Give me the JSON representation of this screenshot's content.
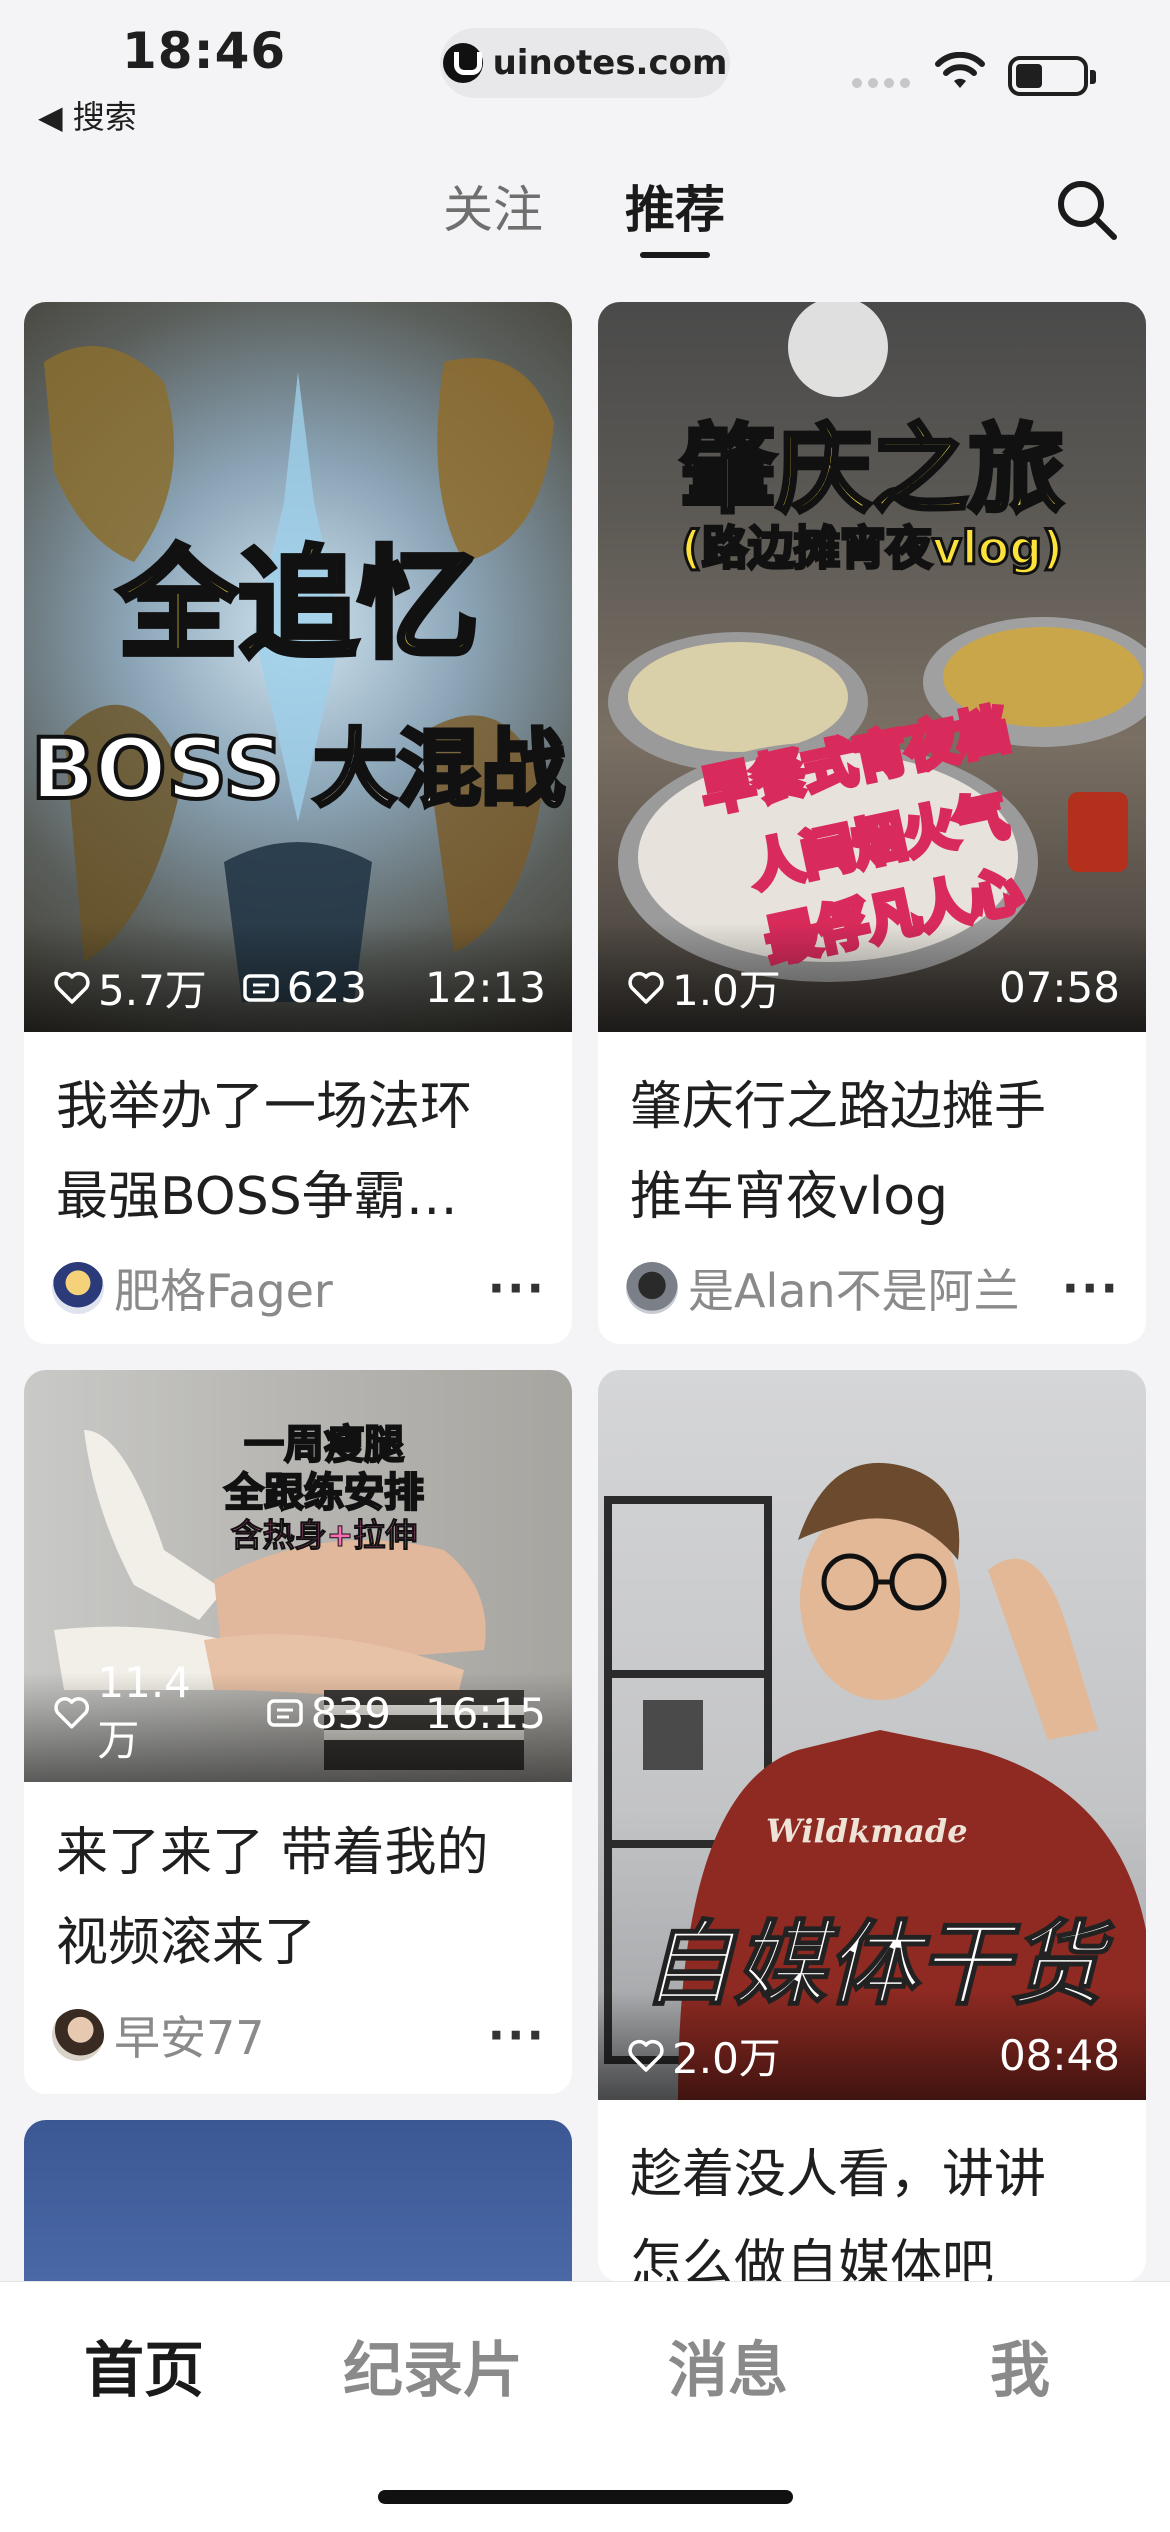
{
  "status_bar": {
    "time": "18:46",
    "back_label": "◀ 搜索",
    "url": "uinotes.com"
  },
  "top_tabs": [
    {
      "label": "关注",
      "active": false
    },
    {
      "label": "推荐",
      "active": true
    }
  ],
  "icons": {
    "search": "search-icon",
    "heart": "heart-icon",
    "danmaku": "danmaku-icon",
    "more": "more-icon"
  },
  "cards": [
    {
      "overlay": {
        "line1": "全追忆",
        "line2": "BOSS 大混战"
      },
      "likes": "5.7万",
      "comments": "623",
      "duration": "12:13",
      "title_line1": "我举办了一场法环",
      "title_line2": "最强BOSS争霸…",
      "author": "肥格Fager",
      "more": "···"
    },
    {
      "overlay": {
        "line1": "肇庆之旅",
        "line2": "(路边摊宵夜vlog)",
        "line3": "早餐式宵夜档",
        "line4": "人间烟火气",
        "line5": "最俘凡人心"
      },
      "likes": "1.0万",
      "duration": "07:58",
      "title_line1": "肇庆行之路边摊手",
      "title_line2": "推车宵夜vlog",
      "author": "是Alan不是阿兰",
      "more": "···"
    },
    {
      "overlay": {
        "line1": "一周瘦腿",
        "line2": "全跟练安排",
        "line3": "含热身+拉伸"
      },
      "likes": "11.4万",
      "comments": "839",
      "duration": "16:15",
      "title_line1": "来了来了 带着我的",
      "title_line2": "视频滚来了",
      "author": "早安77",
      "more": "···"
    },
    {
      "overlay": {
        "shirt": "Wildkmade",
        "line1": "自媒体干货"
      },
      "likes": "2.0万",
      "duration": "08:48",
      "title_line1": "趁着没人看，讲讲",
      "title_line2": "怎么做自媒体吧"
    }
  ],
  "bottom_nav": [
    {
      "label": "首页",
      "active": true
    },
    {
      "label": "纪录片",
      "active": false
    },
    {
      "label": "消息",
      "active": false
    },
    {
      "label": "我",
      "active": false
    }
  ],
  "colors": {
    "background": "#f4f4f6",
    "card": "#ffffff",
    "text_primary": "#1f1f1f",
    "text_secondary": "#8a8a8a",
    "overlay_yellow": "#fde23a"
  }
}
